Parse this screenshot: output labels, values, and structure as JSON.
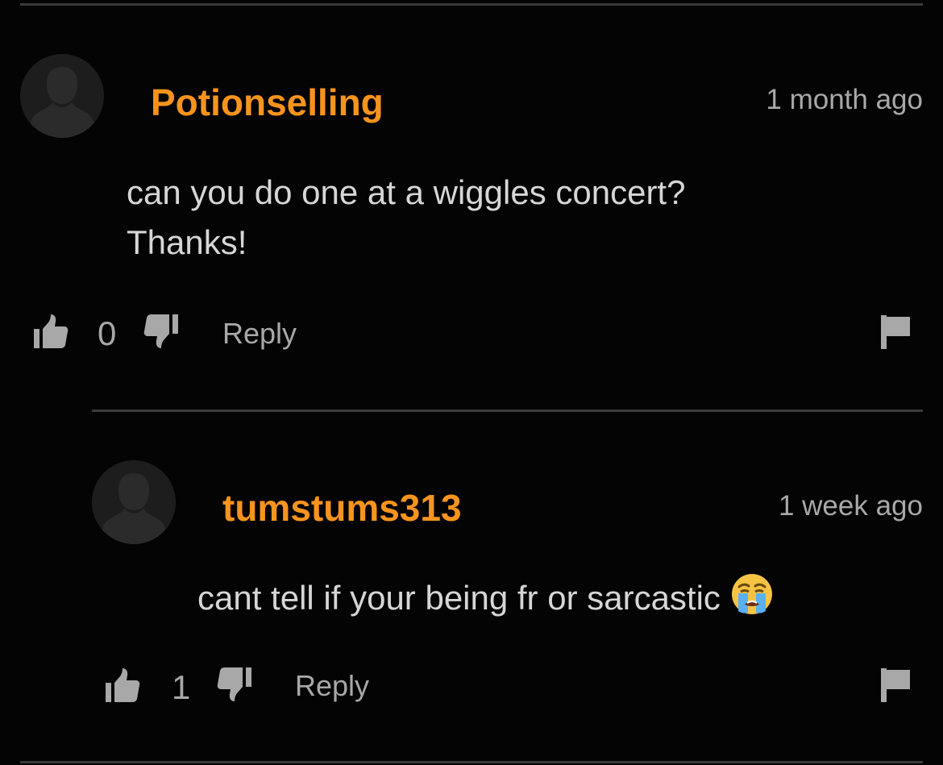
{
  "comments": [
    {
      "username": "Potionselling",
      "timestamp": "1 month ago",
      "lines": [
        "can you do one at a wiggles concert?",
        "Thanks!"
      ],
      "votes": "0",
      "reply_label": "Reply"
    },
    {
      "username": "tumstums313",
      "timestamp": "1 week ago",
      "lines": [
        "cant tell if your being fr or sarcastic"
      ],
      "emoji": "loudly-crying-face",
      "votes": "1",
      "reply_label": "Reply"
    }
  ],
  "colors": {
    "background": "#050405",
    "username": "#f7941d",
    "muted_text": "#a8a8a8",
    "body_text": "#d6d6d6",
    "divider": "#3a3a3a"
  },
  "icons": [
    "avatar-placeholder-icon",
    "thumbs-up-icon",
    "thumbs-down-icon",
    "flag-icon",
    "loudly-crying-face-emoji"
  ]
}
